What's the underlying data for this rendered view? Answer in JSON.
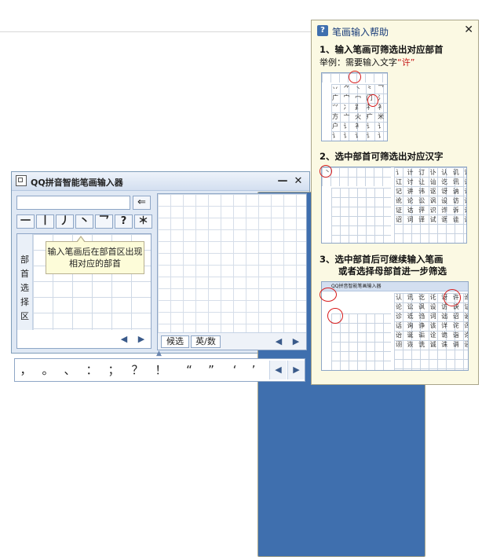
{
  "ime": {
    "title": "QQ拼音智能笔画输入器",
    "help_btn": "?",
    "minimize_btn": "—",
    "close_btn": "✕",
    "backspace": "⇐",
    "strokes": [
      "一",
      "丨",
      "丿",
      "丶",
      "乛",
      "?",
      "＊"
    ],
    "radical_label": [
      "部",
      "首",
      "选",
      "择",
      "区"
    ],
    "tooltip": "输入笔画后在部首区出现相对应的部首",
    "nav_prev": "◀",
    "nav_next": "▶",
    "candidate_btn": "候选",
    "lang_btn": "英/数",
    "punctuation": [
      "，",
      "。",
      "、",
      "：",
      "；",
      "？",
      "！",
      "“",
      "”",
      "‘",
      "’"
    ]
  },
  "help": {
    "title": "笔画输入帮助",
    "close": "✕",
    "step1": "1、输入笔画可筛选出对应部首",
    "example_prefix": "举例：需要输入文字",
    "example_char": "“许”",
    "step2": "2、选中部首可筛选出对应汉字",
    "step3_line1": "3、选中部首后可继续输入笔画",
    "step3_line2": "或者选择母部首进一步筛选",
    "mini3_title": "QQ拼音智能笔画输入器",
    "mini_radicals1": "丷 ⺈ 丶 ⺀ 乛 讠 忄\n广 宀 冖 门 氵 ⻌ ⺌\n⺍ 冫 ⻊ 礻 衤 文 ⺮\n方 亠 火 疒 米 火 讠\n户 讠 衤 讠 讠 认 讯\n讠 讠 讠 讠 讠 讠 讠",
    "mini_chars2": "讠 计 订 讣 认 讥 讦\n讧 讨 让 讪 讫 讯 议\n记 讲 讳 讴 讶 讷 许\n讹 论 讼 讽 设 访 诀\n证 诂 评 识 诈 诉 诊\n诏 词 译 试 诓 诖 诗",
    "mini_chars3": "认 讯 讫 讬 讶 许 讹\n论 讼 讽 设 访 诀 证\n诊 诋 诌 词 诎 诏 诐\n话 询 诤 该 详 诧 诨\n诒 诞 诟 诠 诡 诣 诤\n诩 诙 诜 诚 诛 诮 诬",
    "mini_stroke": "丶"
  }
}
